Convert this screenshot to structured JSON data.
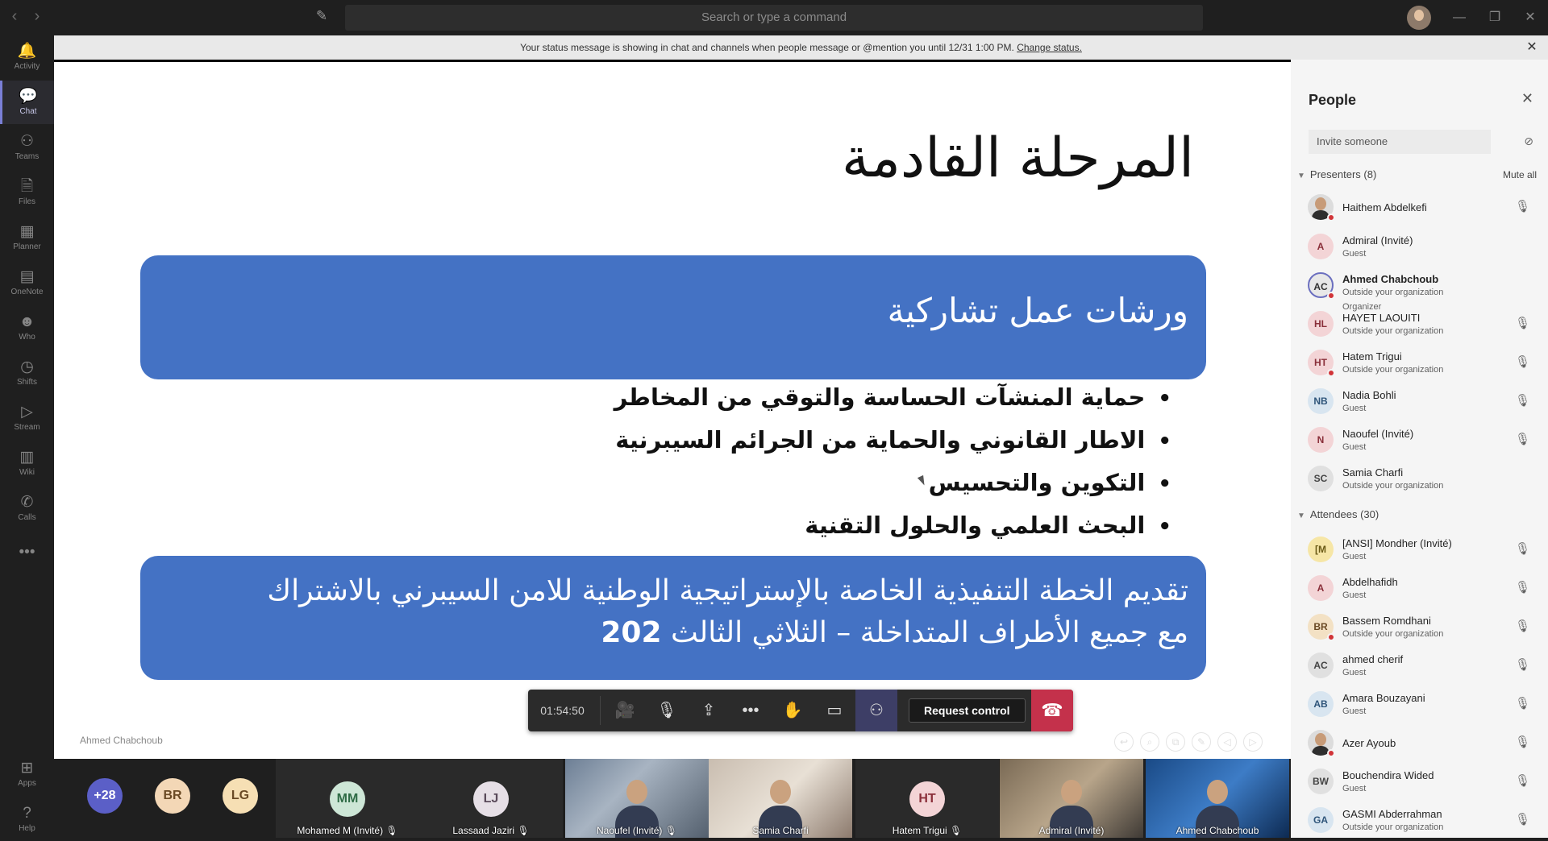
{
  "titlebar": {
    "back_glyph": "‹",
    "forward_glyph": "›",
    "compose_glyph": "✎",
    "search_placeholder": "Search or type a command",
    "minimize_glyph": "—",
    "maximize_glyph": "❐",
    "close_glyph": "✕"
  },
  "rail": [
    {
      "label": "Activity",
      "glyph": "🔔"
    },
    {
      "label": "Chat",
      "glyph": "💬",
      "active": true
    },
    {
      "label": "Teams",
      "glyph": "⚇"
    },
    {
      "label": "Files",
      "glyph": "🗎"
    },
    {
      "label": "Planner",
      "glyph": "▦"
    },
    {
      "label": "OneNote",
      "glyph": "▤"
    },
    {
      "label": "Who",
      "glyph": "☻"
    },
    {
      "label": "Shifts",
      "glyph": "◷"
    },
    {
      "label": "Stream",
      "glyph": "▷"
    },
    {
      "label": "Wiki",
      "glyph": "▥"
    },
    {
      "label": "Calls",
      "glyph": "✆"
    },
    {
      "label": "",
      "glyph": "•••"
    },
    {
      "label": "Apps",
      "glyph": "⊞"
    },
    {
      "label": "Help",
      "glyph": "?"
    }
  ],
  "banner": {
    "text": "Your status message is showing in chat and channels when people message or @mention you until 12/31 1:00 PM. ",
    "link": "Change status.",
    "close_glyph": "✕"
  },
  "slide": {
    "title": "المرحلة القادمة",
    "box1": "ورشات عمل تشاركية",
    "bullets": [
      "حماية المنشآت الحساسة والتوقي من المخاطر",
      "الاطار القانوني والحماية من الجرائم السيبرنية",
      "التكوين والتحسيس",
      "البحث العلمي والحلول التقنية"
    ],
    "box2_line1": "تقديم الخطة التنفيذية الخاصة بالإستراتيجية الوطنية للامن السيبرني بالاشتراك",
    "box2_line2": "مع جميع الأطراف المتداخلة – الثلاثي الثالث",
    "box2_year": "202",
    "presenter": "Ahmed Chabchoub",
    "tools": [
      "↩",
      "⌕",
      "⧉",
      "✎",
      "◁",
      "▷"
    ]
  },
  "controls": {
    "timer": "01:54:50",
    "camera_glyph": "🎥",
    "mic_glyph": "🎙",
    "share_glyph": "⇪",
    "more_glyph": "•••",
    "hand_glyph": "✋",
    "chat_glyph": "▭",
    "people_glyph": "⚇",
    "request_control": "Request control",
    "hangup_glyph": "☎"
  },
  "gallery": {
    "overflow": "+28",
    "avatars": [
      {
        "initials": "BR",
        "bg": "#f3d7b6",
        "fg": "#6a4a25"
      },
      {
        "initials": "LG",
        "bg": "#f6dfb4",
        "fg": "#6a4a25"
      }
    ],
    "tiles": [
      {
        "name": "Mohamed M (Invité)",
        "initials": "MM",
        "bg": "#cde6d6",
        "fg": "#2e6b45",
        "mic": "🎙"
      },
      {
        "name": "Lassaad Jaziri",
        "initials": "LJ",
        "bg": "#e6dfe6",
        "fg": "#5a4a5a",
        "mic": "🎙"
      },
      {
        "name": "Naoufel (Invité)",
        "video": "v1",
        "mic": "🎙"
      },
      {
        "name": "Samia Charfi",
        "video": "v2",
        "mic": ""
      },
      {
        "name": "Hatem Trigui",
        "initials": "HT",
        "bg": "#f3d4d6",
        "fg": "#8a2f3a",
        "mic": "🎙"
      },
      {
        "name": "Admiral (Invité)",
        "video": "v3",
        "mic": ""
      },
      {
        "name": "Ahmed Chabchoub",
        "video": "v4",
        "mic": ""
      }
    ]
  },
  "people": {
    "title": "People",
    "close_glyph": "✕",
    "invite_placeholder": "Invite someone",
    "share_glyph": "⊘",
    "presenters_header": "Presenters (8)",
    "mute_all": "Mute all",
    "attendees_header": "Attendees (30)",
    "caret": "▼",
    "mic_glyph": "🎙",
    "presenters": [
      {
        "name": "Haithem Abdelkefi",
        "photo": true,
        "dot": true,
        "sub": "",
        "mic": true
      },
      {
        "name": "Admiral (Invité)",
        "initials": "A",
        "bg": "#f3d4d6",
        "fg": "#8a2f3a",
        "sub": "Guest",
        "mic": false
      },
      {
        "name": "Ahmed Chabchoub",
        "initials": "AC",
        "bg": "#e8e8e8",
        "fg": "#333",
        "bold": true,
        "organizer": true,
        "dot": true,
        "sub": "Outside your organization",
        "sub2": "Organizer",
        "mic": false
      },
      {
        "name": "HAYET LAOUITI",
        "initials": "HL",
        "bg": "#f3d4d6",
        "fg": "#8a2f3a",
        "sub": "Outside your organization",
        "mic": true
      },
      {
        "name": "Hatem Trigui",
        "initials": "HT",
        "bg": "#f3d4d6",
        "fg": "#8a2f3a",
        "dot": true,
        "sub": "Outside your organization",
        "mic": true
      },
      {
        "name": "Nadia Bohli",
        "initials": "NB",
        "bg": "#d8e5f0",
        "fg": "#2f557a",
        "sub": "Guest",
        "mic": true
      },
      {
        "name": "Naoufel (Invité)",
        "initials": "N",
        "bg": "#f3d4d6",
        "fg": "#8a2f3a",
        "sub": "Guest",
        "mic": true
      },
      {
        "name": "Samia Charfi",
        "initials": "SC",
        "bg": "#e0e0e0",
        "fg": "#444",
        "sub": "Outside your organization",
        "mic": false
      }
    ],
    "attendees": [
      {
        "name": "[ANSI] Mondher (Invité)",
        "initials": "[M",
        "bg": "#f6e6a6",
        "fg": "#6a5a15",
        "sub": "Guest",
        "mic": true
      },
      {
        "name": "Abdelhafidh",
        "initials": "A",
        "bg": "#f3d4d6",
        "fg": "#8a2f3a",
        "sub": "Guest",
        "mic": true
      },
      {
        "name": "Bassem Romdhani",
        "initials": "BR",
        "bg": "#f3e1c4",
        "fg": "#6a4a25",
        "dot": true,
        "sub": "Outside your organization",
        "mic": true
      },
      {
        "name": "ahmed cherif",
        "initials": "AC",
        "bg": "#e0e0e0",
        "fg": "#444",
        "sub": "Guest",
        "mic": true
      },
      {
        "name": "Amara Bouzayani",
        "initials": "AB",
        "bg": "#d8e5f0",
        "fg": "#2f557a",
        "sub": "Guest",
        "mic": true
      },
      {
        "name": "Azer Ayoub",
        "photo": true,
        "dot": true,
        "sub": "",
        "mic": true
      },
      {
        "name": "Bouchendira Wided",
        "initials": "BW",
        "bg": "#e0e0e0",
        "fg": "#444",
        "sub": "Guest",
        "mic": true
      },
      {
        "name": "GASMI Abderrahman",
        "initials": "GA",
        "bg": "#d8e5f0",
        "fg": "#2f557a",
        "sub": "Outside your organization",
        "mic": true
      }
    ]
  }
}
